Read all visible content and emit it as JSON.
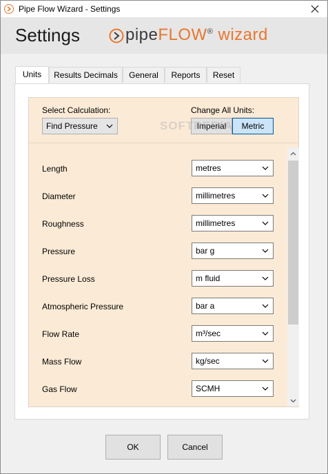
{
  "window": {
    "title": "Pipe Flow Wizard - Settings"
  },
  "header": {
    "title": "Settings",
    "logo": "pipeflow wizard"
  },
  "tabs": [
    {
      "label": "Units"
    },
    {
      "label": "Results Decimals"
    },
    {
      "label": "General"
    },
    {
      "label": "Reports"
    },
    {
      "label": "Reset"
    }
  ],
  "calculation": {
    "label": "Select Calculation:",
    "value": "Find Pressure"
  },
  "change_units": {
    "label": "Change All Units:",
    "imperial": "Imperial",
    "metric": "Metric"
  },
  "units": [
    {
      "label": "Length",
      "value": "metres"
    },
    {
      "label": "Diameter",
      "value": "millimetres"
    },
    {
      "label": "Roughness",
      "value": "millimetres"
    },
    {
      "label": "Pressure",
      "value": "bar g"
    },
    {
      "label": "Pressure Loss",
      "value": "m fluid"
    },
    {
      "label": "Atmospheric Pressure",
      "value": "bar a"
    },
    {
      "label": "Flow Rate",
      "value": "m³/sec"
    },
    {
      "label": "Mass Flow",
      "value": "kg/sec"
    },
    {
      "label": "Gas Flow",
      "value": "SCMH"
    }
  ],
  "buttons": {
    "ok": "OK",
    "cancel": "Cancel"
  },
  "watermark": "SOFTPEDIA",
  "colors": {
    "accent": "#e8772e",
    "panel_bg": "#fbebd6",
    "metric_active": "#cce4f7"
  }
}
